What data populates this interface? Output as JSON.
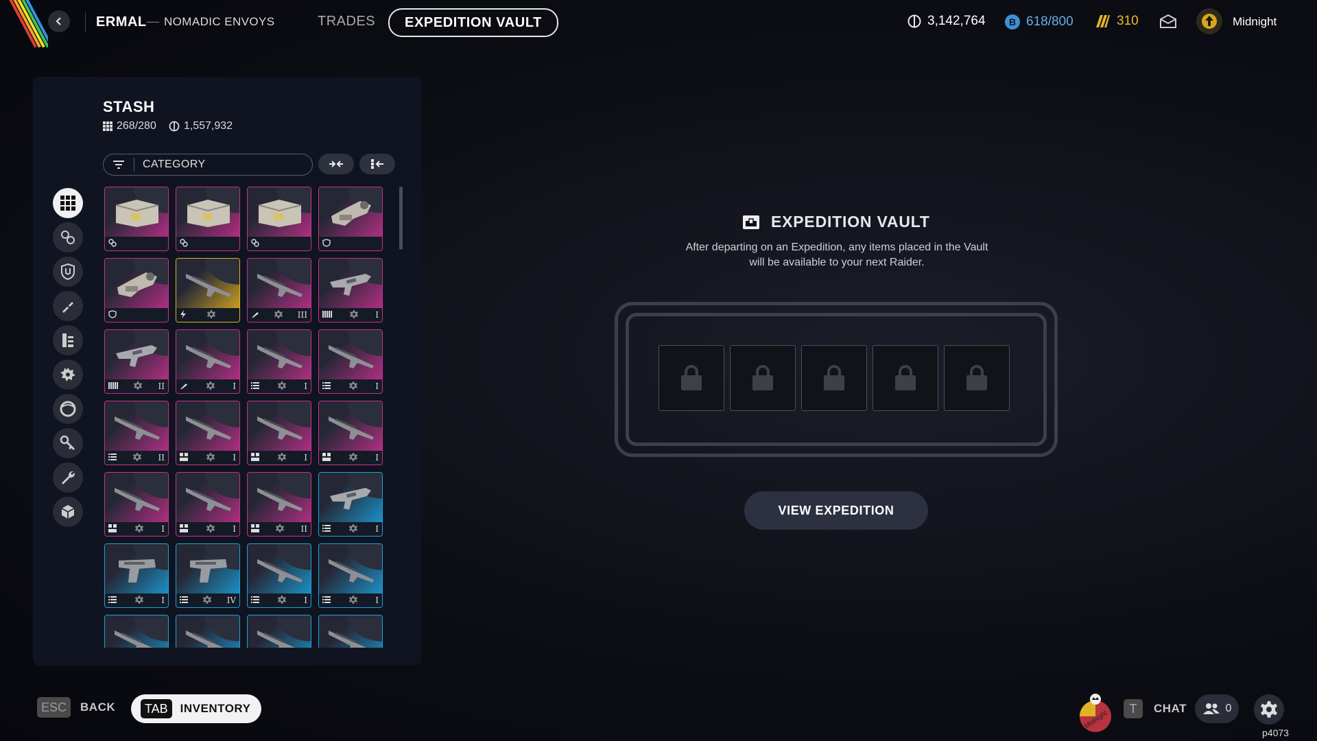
{
  "header": {
    "breadcrumb_main": "ERMAL",
    "breadcrumb_sep": "—",
    "breadcrumb_sub": "NOMADIC ENVOYS",
    "tabs": [
      {
        "label": "TRADES"
      },
      {
        "label": "EXPEDITION VAULT",
        "active": true
      }
    ],
    "currencies": {
      "coins": "3,142,764",
      "tokens": "618/800",
      "premium": "310"
    },
    "profile_name": "Midnight"
  },
  "stash": {
    "title": "STASH",
    "slots": "268/280",
    "value": "1,557,932",
    "filter_label": "CATEGORY"
  },
  "categories": [
    "grid-icon",
    "weapon-mods-icon",
    "shield-icon",
    "ammo-icon",
    "quick-use-icon",
    "materials-icon",
    "augments-icon",
    "keys-icon",
    "tools-icon",
    "misc-icon"
  ],
  "items": [
    {
      "rarity": "epic",
      "kind": "box",
      "icon": "mods",
      "tier": ""
    },
    {
      "rarity": "epic",
      "kind": "box",
      "icon": "mods",
      "tier": ""
    },
    {
      "rarity": "epic",
      "kind": "box",
      "icon": "mods",
      "tier": ""
    },
    {
      "rarity": "epic",
      "kind": "device",
      "icon": "shield",
      "tier": ""
    },
    {
      "rarity": "epic",
      "kind": "device",
      "icon": "shield",
      "tier": ""
    },
    {
      "rarity": "legendary",
      "kind": "rifle",
      "icon": "energy",
      "tier": ""
    },
    {
      "rarity": "epic",
      "kind": "rifle",
      "icon": "bolt",
      "tier": "III"
    },
    {
      "rarity": "epic",
      "kind": "smg",
      "icon": "ammo-bar",
      "tier": "I"
    },
    {
      "rarity": "epic",
      "kind": "smg",
      "icon": "ammo-bar",
      "tier": "II"
    },
    {
      "rarity": "epic",
      "kind": "rifle",
      "icon": "bolt",
      "tier": "I"
    },
    {
      "rarity": "epic",
      "kind": "rifle",
      "icon": "list",
      "tier": "I"
    },
    {
      "rarity": "epic",
      "kind": "rifle",
      "icon": "list",
      "tier": "I"
    },
    {
      "rarity": "epic",
      "kind": "rifle",
      "icon": "list",
      "tier": "II"
    },
    {
      "rarity": "epic",
      "kind": "rifle",
      "icon": "heavy",
      "tier": "I"
    },
    {
      "rarity": "epic",
      "kind": "rifle",
      "icon": "heavy",
      "tier": "I"
    },
    {
      "rarity": "epic",
      "kind": "rifle",
      "icon": "heavy",
      "tier": "I"
    },
    {
      "rarity": "epic",
      "kind": "rifle",
      "icon": "heavy",
      "tier": "I"
    },
    {
      "rarity": "epic",
      "kind": "rifle",
      "icon": "heavy",
      "tier": "I"
    },
    {
      "rarity": "epic",
      "kind": "rifle",
      "icon": "heavy",
      "tier": "II"
    },
    {
      "rarity": "rare",
      "kind": "smg",
      "icon": "list",
      "tier": "I"
    },
    {
      "rarity": "rare",
      "kind": "pistol",
      "icon": "list",
      "tier": "I"
    },
    {
      "rarity": "rare",
      "kind": "pistol",
      "icon": "list",
      "tier": "IV"
    },
    {
      "rarity": "rare",
      "kind": "rifle",
      "icon": "list",
      "tier": "I"
    },
    {
      "rarity": "rare",
      "kind": "rifle",
      "icon": "list",
      "tier": "I"
    },
    {
      "rarity": "rare",
      "kind": "rifle",
      "icon": "",
      "tier": ""
    },
    {
      "rarity": "rare",
      "kind": "rifle",
      "icon": "",
      "tier": ""
    },
    {
      "rarity": "rare",
      "kind": "rifle",
      "icon": "",
      "tier": ""
    },
    {
      "rarity": "rare",
      "kind": "rifle",
      "icon": "",
      "tier": ""
    }
  ],
  "vault": {
    "title": "EXPEDITION VAULT",
    "description_line1": "After departing on an Expedition, any items placed in the Vault",
    "description_line2": "will be available to your next Raider.",
    "slots": [
      {
        "locked": true
      },
      {
        "locked": true
      },
      {
        "locked": true
      },
      {
        "locked": true
      },
      {
        "locked": true
      }
    ],
    "button": "VIEW EXPEDITION"
  },
  "footer": {
    "back_key": "ESC",
    "back_label": "BACK",
    "inventory_key": "TAB",
    "inventory_label": "INVENTORY",
    "chat_key": "T",
    "chat_label": "CHAT",
    "friends_count": "0",
    "build_id": "p4073"
  },
  "colors": {
    "epic": "#c8308f",
    "legendary": "#e3b21e",
    "rare": "#1aa3e0",
    "panel": "#101420"
  }
}
